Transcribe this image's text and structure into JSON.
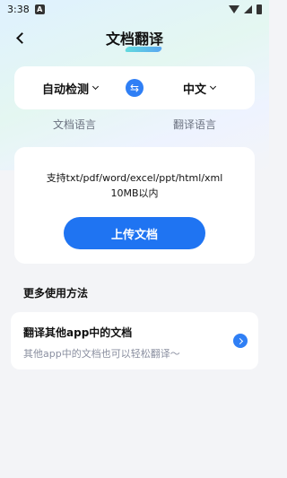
{
  "status_bar": {
    "time": "3:38",
    "app_badge": "A"
  },
  "header": {
    "title": "文档翻译"
  },
  "languages": {
    "source": "自动检测",
    "target": "中文",
    "source_label": "文档语言",
    "target_label": "翻译语言",
    "swap_icon": "⇆"
  },
  "upload": {
    "formats_line1": "支持txt/pdf/word/excel/ppt/html/xml",
    "formats_line2": "10MB以内",
    "button": "上传文档"
  },
  "more": {
    "section_title": "更多使用方法",
    "card_title": "翻译其他app中的文档",
    "card_subtitle": "其他app中的文档也可以轻松翻译〜"
  },
  "colors": {
    "accent": "#1f74f2",
    "background": "#f3f4f7"
  }
}
